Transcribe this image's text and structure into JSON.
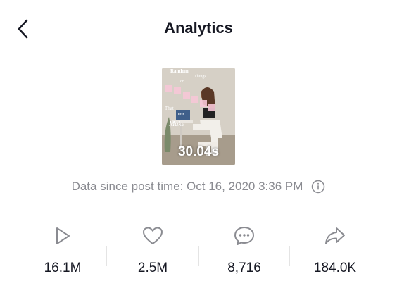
{
  "header": {
    "title": "Analytics"
  },
  "video": {
    "overlay_text": [
      "Random",
      "Things",
      "on",
      "That",
      "Just",
      "Make"
    ],
    "duration": "30.04s"
  },
  "since": {
    "text": "Data since post time: Oct 16, 2020 3:36 PM"
  },
  "stats": {
    "views": "16.1M",
    "likes": "2.5M",
    "comments": "8,716",
    "shares": "184.0K"
  },
  "colors": {
    "text_primary": "#161823",
    "text_secondary": "#8a8b91",
    "icon": "#8a8b91",
    "divider": "#e4e4e4"
  },
  "icons": {
    "back": "chevron-left-icon",
    "info": "info-icon",
    "views": "play-icon",
    "likes": "heart-icon",
    "comments": "comment-bubble-icon",
    "shares": "share-arrow-icon"
  }
}
